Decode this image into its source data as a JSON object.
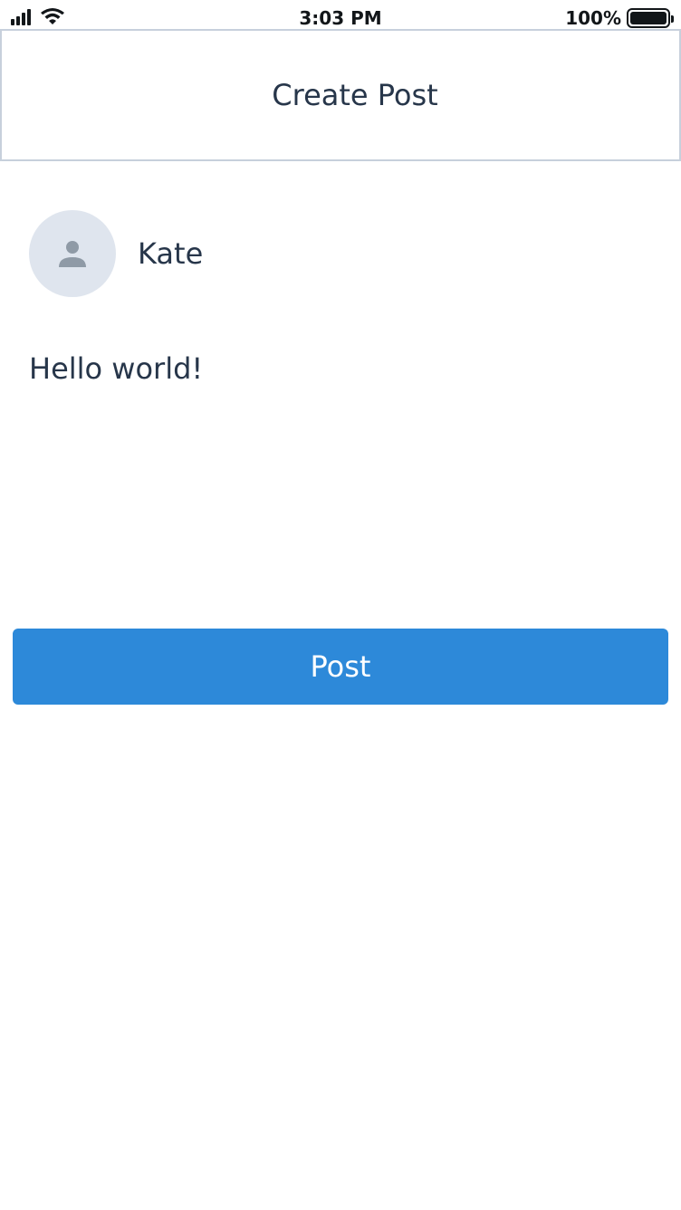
{
  "status_bar": {
    "time": "3:03 PM",
    "battery_percent": "100%",
    "signal_icon": "cellular-signal-icon",
    "wifi_icon": "wifi-icon",
    "battery_icon": "battery-icon",
    "battery_level": 1.0
  },
  "header": {
    "title": "Create Post"
  },
  "author": {
    "name": "Kate",
    "avatar_icon": "person-icon"
  },
  "post": {
    "text": "Hello world!"
  },
  "actions": {
    "post_label": "Post"
  },
  "colors": {
    "primary": "#2d89d9",
    "text": "#27364a",
    "header_border": "#c7d0dc",
    "avatar_bg": "#dfe5ee",
    "avatar_icon": "#8f9aa6"
  }
}
